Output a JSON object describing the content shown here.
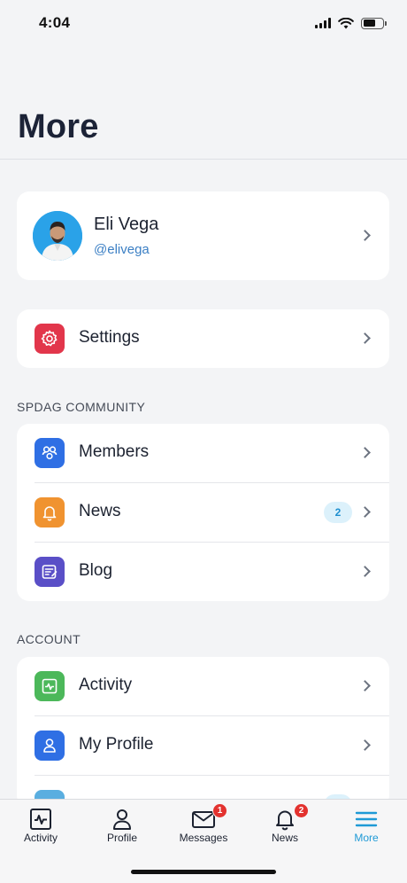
{
  "status": {
    "time": "4:04"
  },
  "header": {
    "title": "More"
  },
  "profile": {
    "name": "Eli Vega",
    "handle": "@elivega"
  },
  "settings": {
    "label": "Settings",
    "icon": "gear-icon",
    "color": "#e2364b"
  },
  "community": {
    "header": "SPDAG COMMUNITY",
    "items": [
      {
        "label": "Members",
        "icon": "members-icon",
        "color": "#2f6fe4"
      },
      {
        "label": "News",
        "icon": "bell-icon",
        "color": "#f09330",
        "badge": "2"
      },
      {
        "label": "Blog",
        "icon": "blog-icon",
        "color": "#5a4fc7"
      }
    ]
  },
  "account": {
    "header": "ACCOUNT",
    "items": [
      {
        "label": "Activity",
        "icon": "activity-icon",
        "color": "#4cb85a"
      },
      {
        "label": "My Profile",
        "icon": "user-icon",
        "color": "#2f6fe4"
      }
    ]
  },
  "tabs": [
    {
      "label": "Activity",
      "icon": "activity-tab-icon"
    },
    {
      "label": "Profile",
      "icon": "profile-tab-icon"
    },
    {
      "label": "Messages",
      "icon": "envelope-icon",
      "badge": "1"
    },
    {
      "label": "News",
      "icon": "bell-tab-icon",
      "badge": "2"
    },
    {
      "label": "More",
      "icon": "menu-icon",
      "active": true
    }
  ],
  "colors": {
    "accent": "#1f9ad6",
    "badge_red": "#e3322f"
  }
}
